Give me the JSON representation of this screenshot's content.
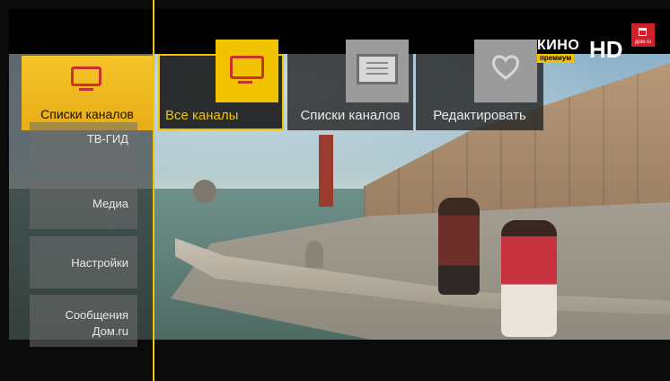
{
  "sidebar": {
    "items": [
      {
        "label": "Списки каналов",
        "icon": "tv-icon",
        "active": true
      },
      {
        "label": "ТВ-ГИД"
      },
      {
        "label": "Медиа"
      },
      {
        "label": "Настройки"
      },
      {
        "label": "Сообщения Дом.ru"
      }
    ]
  },
  "channel_lists": {
    "items": [
      {
        "label": "Все каналы",
        "icon": "tv-icon",
        "active": true
      },
      {
        "label": "Списки каналов",
        "icon": "list-icon"
      },
      {
        "label": "Редактировать",
        "icon": "heart-icon"
      }
    ]
  },
  "channel_logo": {
    "kino": "КИНО",
    "premium": "премиум",
    "hd": "HD"
  },
  "provider_logo": {
    "text": "дом.ru"
  },
  "colors": {
    "accent": "#f2c400",
    "active_tile": "#e8ad16",
    "tv_icon": "#c8342b",
    "provider_red": "#d0202a"
  }
}
